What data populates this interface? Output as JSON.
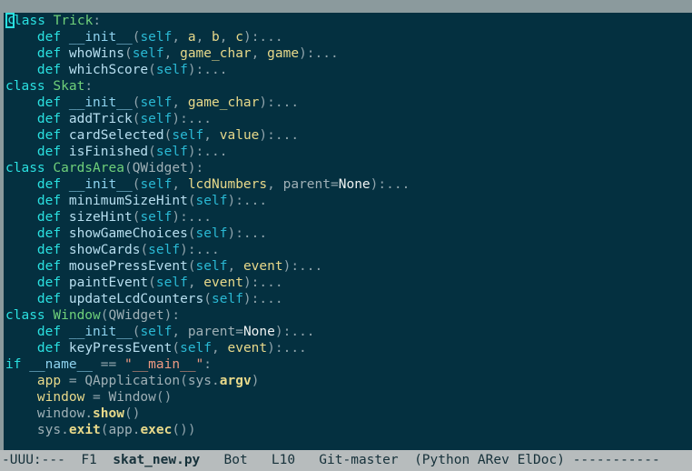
{
  "window": {
    "background": "#043040",
    "chrome_color": "#8b9a9d",
    "modeline_background": "#b7bcbd",
    "cursor_color": "#2ae0e0"
  },
  "buffer": {
    "lines": [
      [
        {
          "t": "class",
          "c": "kw",
          "cursor": true
        },
        {
          "t": " ",
          "c": "punc"
        },
        {
          "t": "Trick",
          "c": "class"
        },
        {
          "t": ":",
          "c": "punc"
        }
      ],
      [
        {
          "t": "    ",
          "c": "punc"
        },
        {
          "t": "def",
          "c": "kw"
        },
        {
          "t": " ",
          "c": "punc"
        },
        {
          "t": "__init__",
          "c": "dunder"
        },
        {
          "t": "(",
          "c": "punc"
        },
        {
          "t": "self",
          "c": "self"
        },
        {
          "t": ", ",
          "c": "punc"
        },
        {
          "t": "a",
          "c": "param"
        },
        {
          "t": ", ",
          "c": "punc"
        },
        {
          "t": "b",
          "c": "param"
        },
        {
          "t": ", ",
          "c": "punc"
        },
        {
          "t": "c",
          "c": "param"
        },
        {
          "t": "):...",
          "c": "punc"
        }
      ],
      [
        {
          "t": "    ",
          "c": "punc"
        },
        {
          "t": "def",
          "c": "kw"
        },
        {
          "t": " ",
          "c": "punc"
        },
        {
          "t": "whoWins",
          "c": "fn"
        },
        {
          "t": "(",
          "c": "punc"
        },
        {
          "t": "self",
          "c": "self"
        },
        {
          "t": ", ",
          "c": "punc"
        },
        {
          "t": "game_char",
          "c": "param"
        },
        {
          "t": ", ",
          "c": "punc"
        },
        {
          "t": "game",
          "c": "param"
        },
        {
          "t": "):...",
          "c": "punc"
        }
      ],
      [
        {
          "t": "    ",
          "c": "punc"
        },
        {
          "t": "def",
          "c": "kw"
        },
        {
          "t": " ",
          "c": "punc"
        },
        {
          "t": "whichScore",
          "c": "fn"
        },
        {
          "t": "(",
          "c": "punc"
        },
        {
          "t": "self",
          "c": "self"
        },
        {
          "t": "):...",
          "c": "punc"
        }
      ],
      [
        {
          "t": "class",
          "c": "kw"
        },
        {
          "t": " ",
          "c": "punc"
        },
        {
          "t": "Skat",
          "c": "class"
        },
        {
          "t": ":",
          "c": "punc"
        }
      ],
      [
        {
          "t": "    ",
          "c": "punc"
        },
        {
          "t": "def",
          "c": "kw"
        },
        {
          "t": " ",
          "c": "punc"
        },
        {
          "t": "__init__",
          "c": "dunder"
        },
        {
          "t": "(",
          "c": "punc"
        },
        {
          "t": "self",
          "c": "self"
        },
        {
          "t": ", ",
          "c": "punc"
        },
        {
          "t": "game_char",
          "c": "param"
        },
        {
          "t": "):...",
          "c": "punc"
        }
      ],
      [
        {
          "t": "    ",
          "c": "punc"
        },
        {
          "t": "def",
          "c": "kw"
        },
        {
          "t": " ",
          "c": "punc"
        },
        {
          "t": "addTrick",
          "c": "fn"
        },
        {
          "t": "(",
          "c": "punc"
        },
        {
          "t": "self",
          "c": "self"
        },
        {
          "t": "):...",
          "c": "punc"
        }
      ],
      [
        {
          "t": "    ",
          "c": "punc"
        },
        {
          "t": "def",
          "c": "kw"
        },
        {
          "t": " ",
          "c": "punc"
        },
        {
          "t": "cardSelected",
          "c": "fn"
        },
        {
          "t": "(",
          "c": "punc"
        },
        {
          "t": "self",
          "c": "self"
        },
        {
          "t": ", ",
          "c": "punc"
        },
        {
          "t": "value",
          "c": "param"
        },
        {
          "t": "):...",
          "c": "punc"
        }
      ],
      [
        {
          "t": "    ",
          "c": "punc"
        },
        {
          "t": "def",
          "c": "kw"
        },
        {
          "t": " ",
          "c": "punc"
        },
        {
          "t": "isFinished",
          "c": "fn"
        },
        {
          "t": "(",
          "c": "punc"
        },
        {
          "t": "self",
          "c": "self"
        },
        {
          "t": "):...",
          "c": "punc"
        }
      ],
      [
        {
          "t": "class",
          "c": "kw"
        },
        {
          "t": " ",
          "c": "punc"
        },
        {
          "t": "CardsArea",
          "c": "class"
        },
        {
          "t": "(",
          "c": "punc"
        },
        {
          "t": "QWidget",
          "c": "plain"
        },
        {
          "t": "):",
          "c": "punc"
        }
      ],
      [
        {
          "t": "    ",
          "c": "punc"
        },
        {
          "t": "def",
          "c": "kw"
        },
        {
          "t": " ",
          "c": "punc"
        },
        {
          "t": "__init__",
          "c": "dunder"
        },
        {
          "t": "(",
          "c": "punc"
        },
        {
          "t": "self",
          "c": "self"
        },
        {
          "t": ", ",
          "c": "punc"
        },
        {
          "t": "lcdNumbers",
          "c": "param"
        },
        {
          "t": ", ",
          "c": "punc"
        },
        {
          "t": "parent",
          "c": "plain"
        },
        {
          "t": "=",
          "c": "punc"
        },
        {
          "t": "None",
          "c": "builtin"
        },
        {
          "t": "):...",
          "c": "punc"
        }
      ],
      [
        {
          "t": "    ",
          "c": "punc"
        },
        {
          "t": "def",
          "c": "kw"
        },
        {
          "t": " ",
          "c": "punc"
        },
        {
          "t": "minimumSizeHint",
          "c": "fn"
        },
        {
          "t": "(",
          "c": "punc"
        },
        {
          "t": "self",
          "c": "self"
        },
        {
          "t": "):...",
          "c": "punc"
        }
      ],
      [
        {
          "t": "    ",
          "c": "punc"
        },
        {
          "t": "def",
          "c": "kw"
        },
        {
          "t": " ",
          "c": "punc"
        },
        {
          "t": "sizeHint",
          "c": "fn"
        },
        {
          "t": "(",
          "c": "punc"
        },
        {
          "t": "self",
          "c": "self"
        },
        {
          "t": "):...",
          "c": "punc"
        }
      ],
      [
        {
          "t": "    ",
          "c": "punc"
        },
        {
          "t": "def",
          "c": "kw"
        },
        {
          "t": " ",
          "c": "punc"
        },
        {
          "t": "showGameChoices",
          "c": "fn"
        },
        {
          "t": "(",
          "c": "punc"
        },
        {
          "t": "self",
          "c": "self"
        },
        {
          "t": "):...",
          "c": "punc"
        }
      ],
      [
        {
          "t": "    ",
          "c": "punc"
        },
        {
          "t": "def",
          "c": "kw"
        },
        {
          "t": " ",
          "c": "punc"
        },
        {
          "t": "showCards",
          "c": "fn"
        },
        {
          "t": "(",
          "c": "punc"
        },
        {
          "t": "self",
          "c": "self"
        },
        {
          "t": "):...",
          "c": "punc"
        }
      ],
      [
        {
          "t": "    ",
          "c": "punc"
        },
        {
          "t": "def",
          "c": "kw"
        },
        {
          "t": " ",
          "c": "punc"
        },
        {
          "t": "mousePressEvent",
          "c": "fn"
        },
        {
          "t": "(",
          "c": "punc"
        },
        {
          "t": "self",
          "c": "self"
        },
        {
          "t": ", ",
          "c": "punc"
        },
        {
          "t": "event",
          "c": "param"
        },
        {
          "t": "):...",
          "c": "punc"
        }
      ],
      [
        {
          "t": "    ",
          "c": "punc"
        },
        {
          "t": "def",
          "c": "kw"
        },
        {
          "t": " ",
          "c": "punc"
        },
        {
          "t": "paintEvent",
          "c": "fn"
        },
        {
          "t": "(",
          "c": "punc"
        },
        {
          "t": "self",
          "c": "self"
        },
        {
          "t": ", ",
          "c": "punc"
        },
        {
          "t": "event",
          "c": "param"
        },
        {
          "t": "):...",
          "c": "punc"
        }
      ],
      [
        {
          "t": "    ",
          "c": "punc"
        },
        {
          "t": "def",
          "c": "kw"
        },
        {
          "t": " ",
          "c": "punc"
        },
        {
          "t": "updateLcdCounters",
          "c": "fn"
        },
        {
          "t": "(",
          "c": "punc"
        },
        {
          "t": "self",
          "c": "self"
        },
        {
          "t": "):...",
          "c": "punc"
        }
      ],
      [
        {
          "t": "class",
          "c": "kw"
        },
        {
          "t": " ",
          "c": "punc"
        },
        {
          "t": "Window",
          "c": "class"
        },
        {
          "t": "(",
          "c": "punc"
        },
        {
          "t": "QWidget",
          "c": "plain"
        },
        {
          "t": "):",
          "c": "punc"
        }
      ],
      [
        {
          "t": "    ",
          "c": "punc"
        },
        {
          "t": "def",
          "c": "kw"
        },
        {
          "t": " ",
          "c": "punc"
        },
        {
          "t": "__init__",
          "c": "dunder"
        },
        {
          "t": "(",
          "c": "punc"
        },
        {
          "t": "self",
          "c": "self"
        },
        {
          "t": ", ",
          "c": "punc"
        },
        {
          "t": "parent",
          "c": "plain"
        },
        {
          "t": "=",
          "c": "punc"
        },
        {
          "t": "None",
          "c": "builtin"
        },
        {
          "t": "):...",
          "c": "punc"
        }
      ],
      [
        {
          "t": "    ",
          "c": "punc"
        },
        {
          "t": "def",
          "c": "kw"
        },
        {
          "t": " ",
          "c": "punc"
        },
        {
          "t": "keyPressEvent",
          "c": "fn"
        },
        {
          "t": "(",
          "c": "punc"
        },
        {
          "t": "self",
          "c": "self"
        },
        {
          "t": ", ",
          "c": "punc"
        },
        {
          "t": "event",
          "c": "param"
        },
        {
          "t": "):...",
          "c": "punc"
        }
      ],
      [
        {
          "t": "if",
          "c": "kw"
        },
        {
          "t": " ",
          "c": "punc"
        },
        {
          "t": "__name__",
          "c": "name"
        },
        {
          "t": " ",
          "c": "punc"
        },
        {
          "t": "==",
          "c": "op"
        },
        {
          "t": " ",
          "c": "punc"
        },
        {
          "t": "\"__main__\"",
          "c": "str"
        },
        {
          "t": ":",
          "c": "punc"
        }
      ],
      [
        {
          "t": "    ",
          "c": "punc"
        },
        {
          "t": "app",
          "c": "var"
        },
        {
          "t": " ",
          "c": "punc"
        },
        {
          "t": "=",
          "c": "op"
        },
        {
          "t": " ",
          "c": "punc"
        },
        {
          "t": "QApplication",
          "c": "plain"
        },
        {
          "t": "(",
          "c": "punc"
        },
        {
          "t": "sys",
          "c": "plain"
        },
        {
          "t": ".",
          "c": "punc"
        },
        {
          "t": "argv",
          "c": "attr"
        },
        {
          "t": ")",
          "c": "punc"
        }
      ],
      [
        {
          "t": "    ",
          "c": "punc"
        },
        {
          "t": "window",
          "c": "var"
        },
        {
          "t": " ",
          "c": "punc"
        },
        {
          "t": "=",
          "c": "op"
        },
        {
          "t": " ",
          "c": "punc"
        },
        {
          "t": "Window",
          "c": "plain"
        },
        {
          "t": "()",
          "c": "punc"
        }
      ],
      [
        {
          "t": "    ",
          "c": "punc"
        },
        {
          "t": "window",
          "c": "plain"
        },
        {
          "t": ".",
          "c": "punc"
        },
        {
          "t": "show",
          "c": "attr"
        },
        {
          "t": "()",
          "c": "punc"
        }
      ],
      [
        {
          "t": "    ",
          "c": "punc"
        },
        {
          "t": "sys",
          "c": "plain"
        },
        {
          "t": ".",
          "c": "punc"
        },
        {
          "t": "exit",
          "c": "attr"
        },
        {
          "t": "(",
          "c": "punc"
        },
        {
          "t": "app",
          "c": "plain"
        },
        {
          "t": ".",
          "c": "punc"
        },
        {
          "t": "exec",
          "c": "attr"
        },
        {
          "t": "())",
          "c": "punc"
        }
      ]
    ]
  },
  "mode_line": {
    "state": "-UUU:---",
    "frame": "F1",
    "buffer_name": "skat_new.py",
    "position": "Bot",
    "line_number": "L10",
    "vc_mode": "Git-master",
    "major_minor_modes": "(Python ARev ElDoc)",
    "filler": "-----------",
    "full_text": "-UUU:---  F1  skat_new.py   Bot   L10   Git-master  (Python ARev ElDoc) -----------"
  }
}
